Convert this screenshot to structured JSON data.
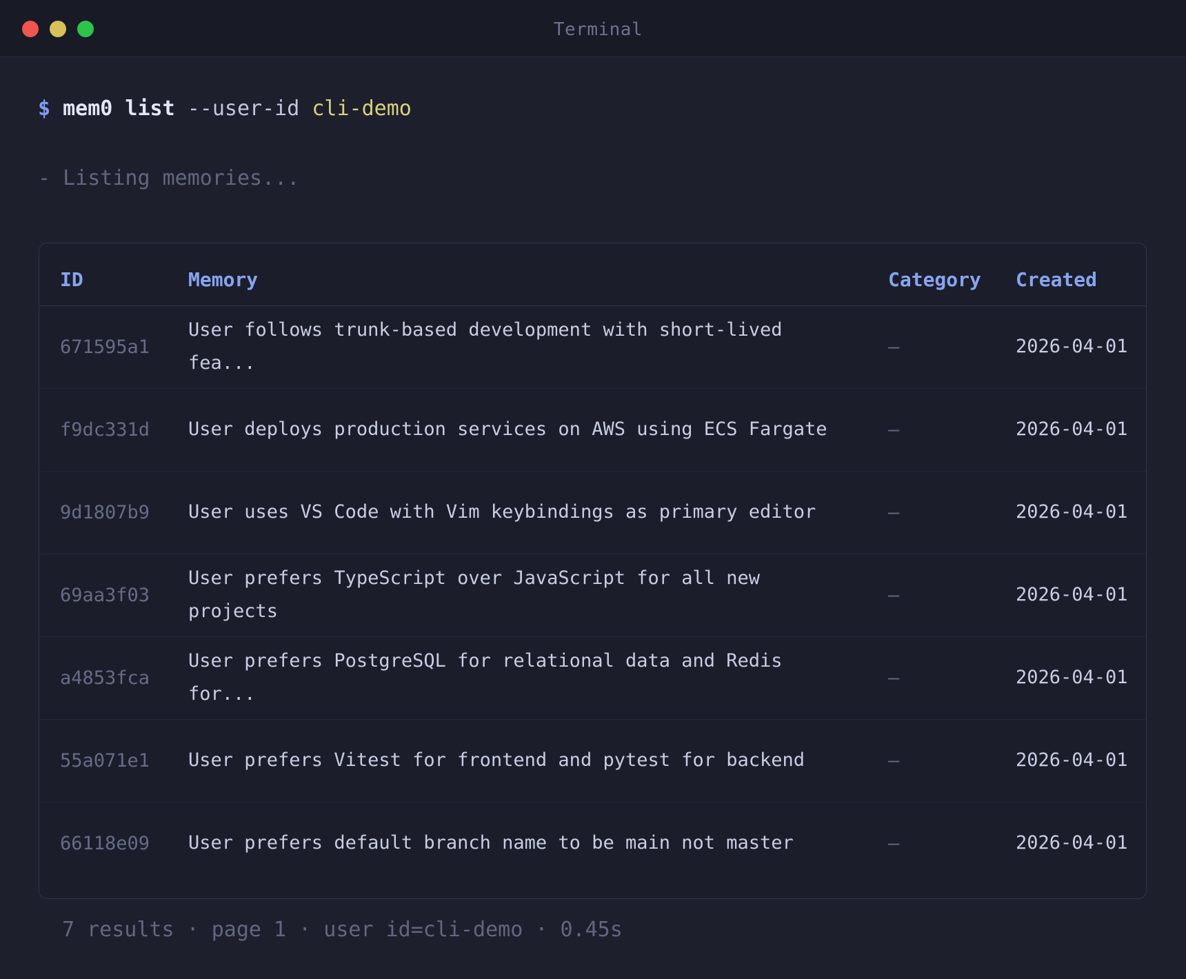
{
  "window": {
    "title": "Terminal"
  },
  "command": {
    "prompt": "$",
    "program": "mem0 list",
    "flag": "--user-id",
    "value": "cli-demo"
  },
  "status": "- Listing memories...",
  "table": {
    "headers": {
      "id": "ID",
      "memory": "Memory",
      "category": "Category",
      "created": "Created"
    },
    "rows": [
      {
        "id": "671595a1",
        "memory": "User follows trunk-based development with short-lived fea...",
        "category": "—",
        "created": "2026-04-01"
      },
      {
        "id": "f9dc331d",
        "memory": "User deploys production services on AWS using ECS Fargate",
        "category": "—",
        "created": "2026-04-01"
      },
      {
        "id": "9d1807b9",
        "memory": "User uses VS Code with Vim keybindings as primary editor",
        "category": "—",
        "created": "2026-04-01"
      },
      {
        "id": "69aa3f03",
        "memory": "User prefers TypeScript over JavaScript for all new projects",
        "category": "—",
        "created": "2026-04-01"
      },
      {
        "id": "a4853fca",
        "memory": "User prefers PostgreSQL for relational data and Redis for...",
        "category": "—",
        "created": "2026-04-01"
      },
      {
        "id": "55a071e1",
        "memory": "User prefers Vitest for frontend and pytest for backend",
        "category": "—",
        "created": "2026-04-01"
      },
      {
        "id": "66118e09",
        "memory": "User prefers default branch name to be main not master",
        "category": "—",
        "created": "2026-04-01"
      }
    ]
  },
  "footer": "7 results · page 1 · user id=cli-demo · 0.45s",
  "colors": {
    "background": "#1d1f2d",
    "titlebar": "#181a25",
    "header_text": "#87a5ef",
    "command_value": "#d8d27c",
    "traffic_red": "#f0554f",
    "traffic_yellow": "#d6c15b",
    "traffic_green": "#2ec34a"
  }
}
